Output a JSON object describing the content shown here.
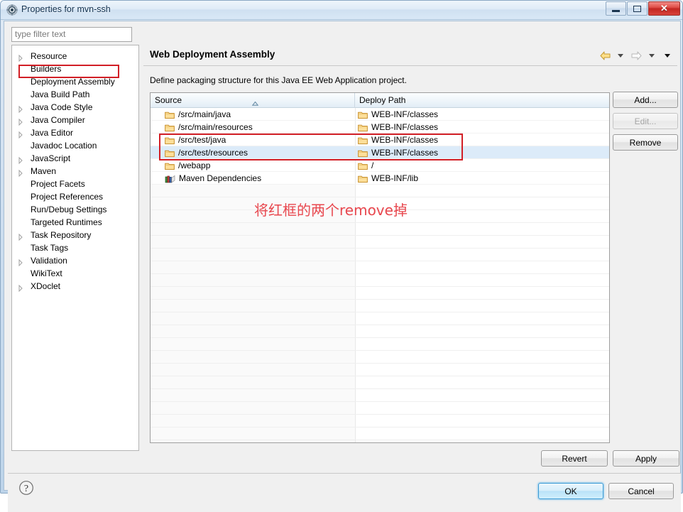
{
  "window": {
    "title": "Properties for mvn-ssh",
    "icon": "gear-icon",
    "minimize_label": "Minimize",
    "maximize_label": "Maximize",
    "close_label": "✕"
  },
  "filter": {
    "placeholder": "type filter text",
    "value": ""
  },
  "sidebar": {
    "selected": "Deployment Assembly",
    "items": [
      {
        "label": "Resource",
        "expandable": true
      },
      {
        "label": "Builders",
        "expandable": false
      },
      {
        "label": "Deployment Assembly",
        "expandable": false
      },
      {
        "label": "Java Build Path",
        "expandable": false
      },
      {
        "label": "Java Code Style",
        "expandable": true
      },
      {
        "label": "Java Compiler",
        "expandable": true
      },
      {
        "label": "Java Editor",
        "expandable": true
      },
      {
        "label": "Javadoc Location",
        "expandable": false
      },
      {
        "label": "JavaScript",
        "expandable": true
      },
      {
        "label": "Maven",
        "expandable": true
      },
      {
        "label": "Project Facets",
        "expandable": false
      },
      {
        "label": "Project References",
        "expandable": false
      },
      {
        "label": "Run/Debug Settings",
        "expandable": false
      },
      {
        "label": "Targeted Runtimes",
        "expandable": false
      },
      {
        "label": "Task Repository",
        "expandable": true
      },
      {
        "label": "Task Tags",
        "expandable": false
      },
      {
        "label": "Validation",
        "expandable": true
      },
      {
        "label": "WikiText",
        "expandable": false
      },
      {
        "label": "XDoclet",
        "expandable": true
      }
    ]
  },
  "page": {
    "title": "Web Deployment Assembly",
    "description": "Define packaging structure for this Java EE Web Application project."
  },
  "nav": {
    "back_icon": "back-arrow-icon",
    "back_menu_icon": "chevron-down-icon",
    "forward_icon": "forward-arrow-icon",
    "forward_menu_icon": "chevron-down-icon",
    "view_menu_icon": "chevron-down-icon"
  },
  "table": {
    "columns": [
      "Source",
      "Deploy Path"
    ],
    "sort_column": "Source",
    "sort_direction": "ascending",
    "rows": [
      {
        "source": "/src/main/java",
        "deploy": "WEB-INF/classes",
        "icon": "folder-icon",
        "deploy_icon": "folder-icon",
        "selected": false,
        "highlighted": false
      },
      {
        "source": "/src/main/resources",
        "deploy": "WEB-INF/classes",
        "icon": "folder-icon",
        "deploy_icon": "folder-icon",
        "selected": false,
        "highlighted": false
      },
      {
        "source": "/src/test/java",
        "deploy": "WEB-INF/classes",
        "icon": "folder-icon",
        "deploy_icon": "folder-icon",
        "selected": false,
        "highlighted": true
      },
      {
        "source": "/src/test/resources",
        "deploy": "WEB-INF/classes",
        "icon": "folder-icon",
        "deploy_icon": "folder-icon",
        "selected": true,
        "highlighted": true
      },
      {
        "source": "/webapp",
        "deploy": "/",
        "icon": "folder-icon",
        "deploy_icon": "folder-icon",
        "selected": false,
        "highlighted": false
      },
      {
        "source": "Maven Dependencies",
        "deploy": "WEB-INF/lib",
        "icon": "books-icon",
        "deploy_icon": "folder-icon",
        "selected": false,
        "highlighted": false
      }
    ]
  },
  "annotation": {
    "text": "将红框的两个remove掉",
    "color": "#e8474e",
    "box_color": "#d21f26"
  },
  "side_buttons": {
    "add": "Add...",
    "edit": "Edit...",
    "edit_disabled": true,
    "remove": "Remove"
  },
  "bottom_buttons": {
    "revert": "Revert",
    "apply": "Apply",
    "ok": "OK",
    "cancel": "Cancel"
  },
  "footer": {
    "help_icon": "help-icon"
  }
}
